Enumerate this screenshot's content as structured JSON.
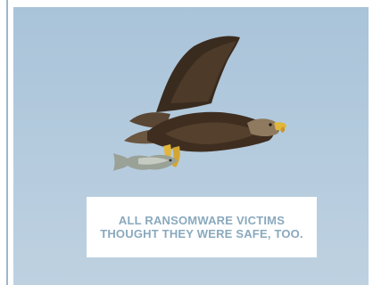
{
  "ad": {
    "caption": {
      "line1": "ALL RANSOMWARE VICTIMS",
      "line2": "THOUGHT THEY WERE SAFE, TOO."
    },
    "photo": {
      "subject": "eagle-icon",
      "prey": "fish-icon"
    },
    "colors": {
      "sky": "#b3cadd",
      "caption_text": "#8aa9bd",
      "caption_box": "#ffffff",
      "frame_rule": "#9db6c9"
    }
  }
}
